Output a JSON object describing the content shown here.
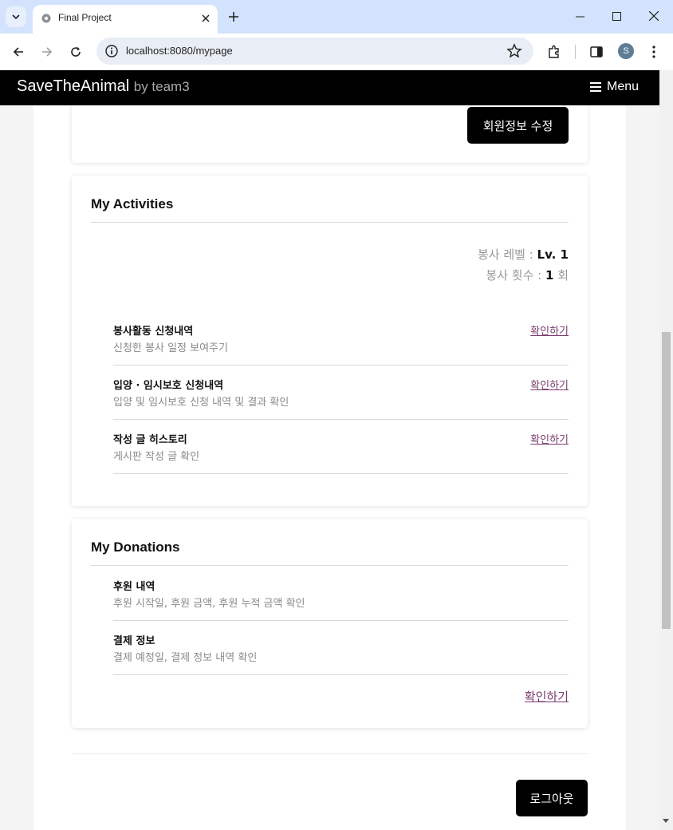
{
  "browser": {
    "tab_title": "Final Project",
    "url": "localhost:8080/mypage",
    "profile_initial": "S"
  },
  "site": {
    "brand": "SaveTheAnimal",
    "brand_sub": "by team3",
    "menu_label": "Menu"
  },
  "profile_card": {
    "edit_button": "회원정보 수정"
  },
  "activities": {
    "title": "My Activities",
    "level_label": "봉사 레벨 : ",
    "level_value": "Lv. 1",
    "count_label": "봉사 횟수 : ",
    "count_value": "1",
    "count_unit": " 회",
    "items": [
      {
        "title": "봉사활동 신청내역",
        "desc": "신청한 봉사 일정 보여주기",
        "link": "확인하기"
      },
      {
        "title": "입양 · 임시보호 신청내역",
        "desc": "입양 및 임시보호 신청 내역 및 결과 확인",
        "link": "확인하기"
      },
      {
        "title": "작성 글 히스토리",
        "desc": "게시판 작성 글 확인",
        "link": "확인하기"
      }
    ]
  },
  "donations": {
    "title": "My Donations",
    "items": [
      {
        "title": "후원 내역",
        "desc": "후원 시작일, 후원 금액, 후원 누적 금액 확인"
      },
      {
        "title": "결제 정보",
        "desc": "결제 예정일, 결제 정보 내역 확인"
      }
    ],
    "link": "확인하기"
  },
  "logout_button": "로그아웃",
  "colors": {
    "tabstrip": "#d3e3fd",
    "navbar": "#000000",
    "link": "#7a3b6e",
    "button": "#000000"
  }
}
